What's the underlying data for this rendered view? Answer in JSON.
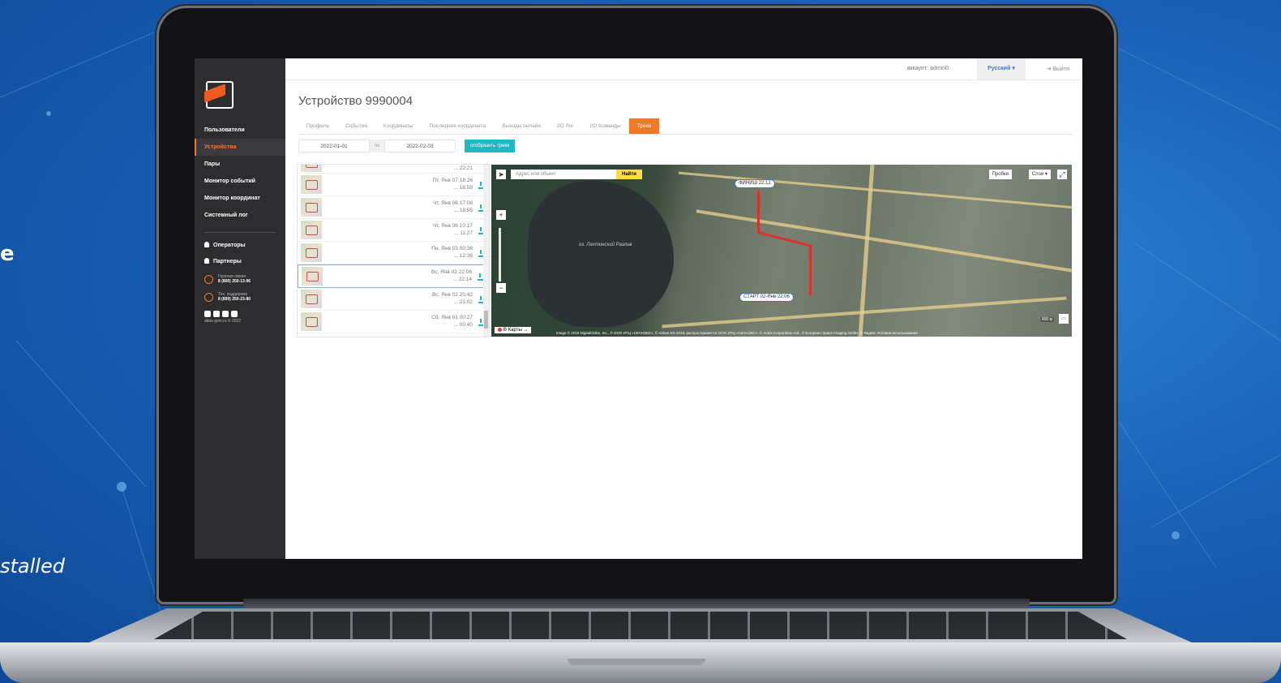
{
  "background_text": {
    "fragment_top": "e",
    "fragment_bottom": "stalled"
  },
  "sidebar": {
    "items": [
      {
        "label": "Пользователи",
        "active": false
      },
      {
        "label": "Устройства",
        "active": true
      },
      {
        "label": "Пары",
        "active": false
      },
      {
        "label": "Монитор событий",
        "active": false
      },
      {
        "label": "Монитор координат",
        "active": false
      },
      {
        "label": "Системный лог",
        "active": false
      }
    ],
    "secondary": [
      {
        "label": "Операторы"
      },
      {
        "label": "Партнеры"
      }
    ],
    "hotline": {
      "label": "Горячая линия",
      "phone": "8 (800) 250-13-96"
    },
    "support": {
      "label": "Тех. поддержка",
      "phone": "8 (800) 250-23-80"
    },
    "copyright": "atlas-gsm.ru © 2022"
  },
  "topbar": {
    "account_label": "аккаунт:",
    "account_name": "admin0",
    "language": "Русский ▾",
    "logout": "Выйти"
  },
  "page": {
    "title": "Устройство 9990004",
    "tabs": [
      {
        "label": "Профиль",
        "active": false
      },
      {
        "label": "События",
        "active": false
      },
      {
        "label": "Координаты",
        "active": false
      },
      {
        "label": "Последняя координата",
        "active": false
      },
      {
        "label": "Выходы онлайн",
        "active": false
      },
      {
        "label": "I/O Лог",
        "active": false
      },
      {
        "label": "I/O Команды",
        "active": false
      },
      {
        "label": "Треки",
        "active": true
      }
    ],
    "date_from": "2022-01-01",
    "date_separator": "по",
    "date_to": "2022-02-03",
    "show_button": "отобразить треки"
  },
  "tracks": [
    {
      "start": "",
      "end": "22:21",
      "selected": false
    },
    {
      "start": "Пт, Янв 07 18:26",
      "end": "18:59",
      "selected": false
    },
    {
      "start": "Чт, Янв 06 17:08",
      "end": "18:55",
      "selected": false
    },
    {
      "start": "Чт, Янв 06 10:17",
      "end": "11:27",
      "selected": false
    },
    {
      "start": "Пн, Янв 03 00:36",
      "end": "12:36",
      "selected": false
    },
    {
      "start": "Вс, Янв 02 22:06",
      "end": "22:14",
      "selected": true
    },
    {
      "start": "Вс, Янв 02 20:42",
      "end": "21:02",
      "selected": false
    },
    {
      "start": "Сб, Янв 01 00:27",
      "end": "00:40",
      "selected": false
    }
  ],
  "map": {
    "search_placeholder": "Адрес или объект",
    "find_button": "Найти",
    "traffic_button": "Пробки",
    "layers_button": "Слои ▾",
    "finish_label": "ФИНИШ 22:12",
    "start_label": "СТАРТ 02-Янв 22:06",
    "lake_label": "оз. Лахтинский Разлив",
    "yandex_button": "В Карты →",
    "scale": "400 м",
    "copyright": "Image © 2018 DigitalGlobe, Inc., © ООО ИТЦ «СКАНЭКС», © Airbus DS 2019, распространяется ООО ИТЦ «СКАНЭКС», © Antrix Corporation Ltd., © European Space Imaging GmbH, © Яндекс Условия использования"
  },
  "colors": {
    "accent": "#f07a2a",
    "teal": "#20b7c3",
    "route": "#d93030"
  }
}
